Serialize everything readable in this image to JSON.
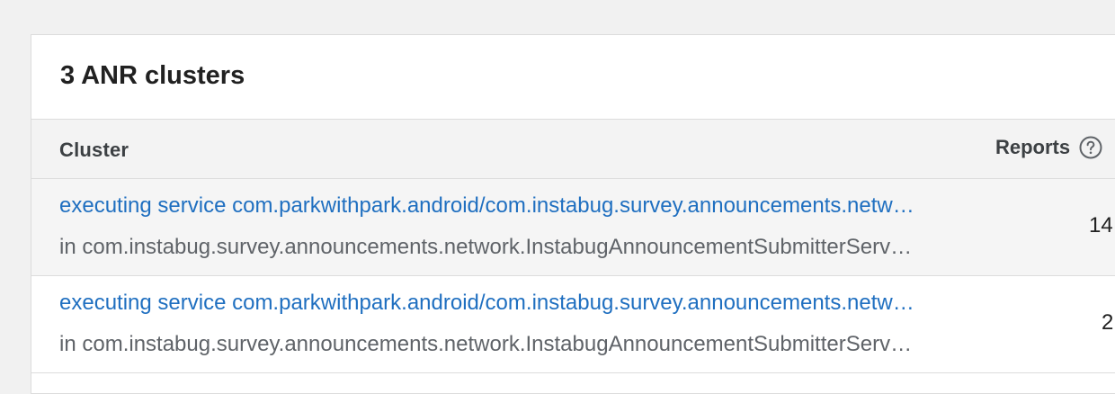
{
  "card": {
    "title": "3 ANR clusters"
  },
  "table": {
    "columns": {
      "cluster": "Cluster",
      "reports": "Reports"
    },
    "rows": [
      {
        "title": "executing service com.parkwithpark.android/com.instabug.survey.announcements.network.InstabugAnnouncementSubmitterService",
        "subtitle": "in com.instabug.survey.announcements.network.InstabugAnnouncementSubmitterService",
        "reports": "14"
      },
      {
        "title": "executing service com.parkwithpark.android/com.instabug.survey.announcements.network.InstabugAnnouncementSubmitterService",
        "subtitle": "in com.instabug.survey.announcements.network.InstabugAnnouncementSubmitterService",
        "reports": "2"
      }
    ]
  },
  "icons": {
    "help": "help-circle-icon"
  },
  "colors": {
    "link": "#1f6fc0",
    "header_bg": "#f3f3f3",
    "page_bg": "#f1f1f1"
  }
}
